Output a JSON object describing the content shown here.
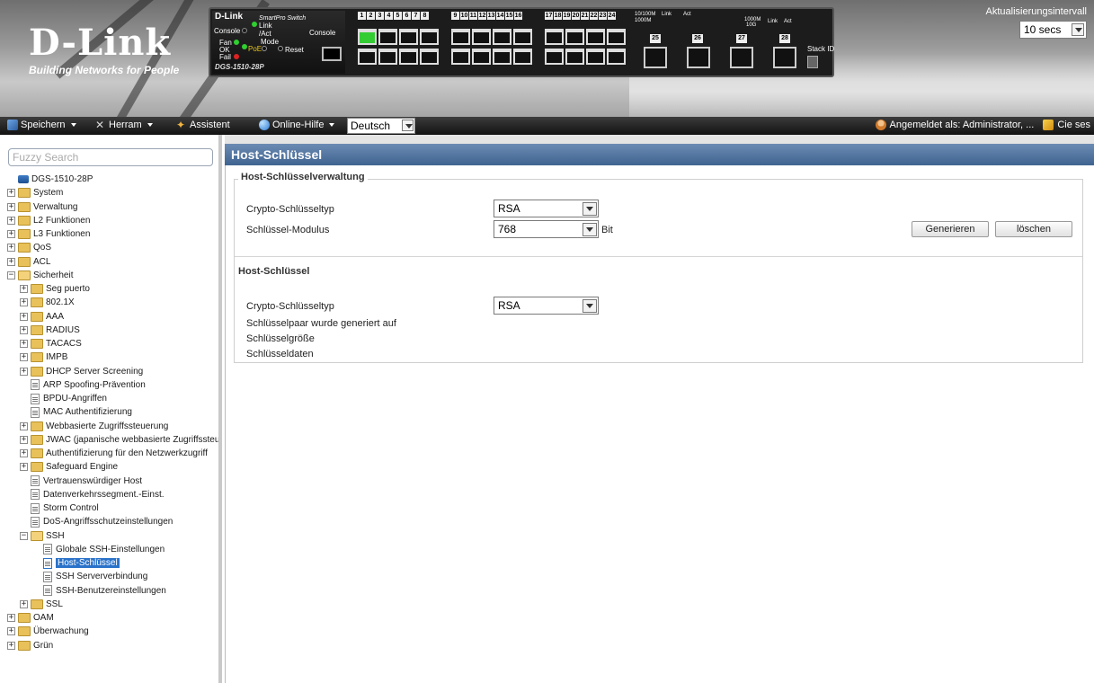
{
  "header": {
    "brand": "D-Link",
    "tagline": "Building Networks for People",
    "panel": {
      "brand": "D-Link",
      "series": "SmartPro Switch",
      "model": "DGS-1510-28P",
      "labels": {
        "console": "Console",
        "link_act": "Link /Act",
        "fan": "Fan",
        "ok": "OK",
        "fail": "Fail",
        "mode": "Mode",
        "poe": "PoE",
        "reset": "Reset",
        "console_port": "Console",
        "stack_id": "Stack ID",
        "speed_1": "10/100M",
        "speed_2": "1000M",
        "speed_3": "1000M",
        "speed_4": "10G",
        "link": "Link",
        "act": "Act"
      },
      "port_numbers_1": [
        "1",
        "2",
        "3",
        "4",
        "5",
        "6",
        "7",
        "8"
      ],
      "port_numbers_2": [
        "9",
        "10",
        "11",
        "12",
        "13",
        "14",
        "15",
        "16"
      ],
      "port_numbers_3": [
        "17",
        "18",
        "19",
        "20",
        "21",
        "22",
        "23",
        "24"
      ],
      "sfp_numbers": [
        "25",
        "26",
        "27",
        "28"
      ]
    },
    "refresh": {
      "label": "Aktualisierungsintervall",
      "value": "10 secs"
    }
  },
  "toolbar": {
    "save": "Speichern",
    "tools": "Herram",
    "wizard": "Assistent",
    "help": "Online-Hilfe",
    "language": "Deutsch",
    "user": "Angemeldet als: Administrator, ...",
    "logout": "Cie ses"
  },
  "sidebar": {
    "search_placeholder": "Fuzzy Search",
    "tree": [
      {
        "label": "DGS-1510-28P"
      },
      {
        "label": "System"
      },
      {
        "label": "Verwaltung"
      },
      {
        "label": "L2 Funktionen"
      },
      {
        "label": "L3 Funktionen"
      },
      {
        "label": "QoS"
      },
      {
        "label": "ACL"
      },
      {
        "label": "Sicherheit"
      },
      {
        "label": "Seg puerto"
      },
      {
        "label": "802.1X"
      },
      {
        "label": "AAA"
      },
      {
        "label": "RADIUS"
      },
      {
        "label": "TACACS"
      },
      {
        "label": "IMPB"
      },
      {
        "label": "DHCP Server Screening"
      },
      {
        "label": "ARP Spoofing-Prävention"
      },
      {
        "label": "BPDU-Angriffen"
      },
      {
        "label": "MAC Authentifizierung"
      },
      {
        "label": "Webbasierte Zugriffssteuerung"
      },
      {
        "label": "JWAC (japanische webbasierte Zugriffssteue"
      },
      {
        "label": "Authentifizierung für den Netzwerkzugriff"
      },
      {
        "label": "Safeguard Engine"
      },
      {
        "label": "Vertrauenswürdiger Host"
      },
      {
        "label": "Datenverkehrssegment.-Einst."
      },
      {
        "label": "Storm Control"
      },
      {
        "label": "DoS-Angriffsschutzeinstellungen"
      },
      {
        "label": "SSH"
      },
      {
        "label": "Globale SSH-Einstellungen"
      },
      {
        "label": "Host-Schlüssel"
      },
      {
        "label": "SSH Serververbindung"
      },
      {
        "label": "SSH-Benutzereinstellungen"
      },
      {
        "label": "SSL"
      },
      {
        "label": "OAM"
      },
      {
        "label": "Überwachung"
      },
      {
        "label": "Grün"
      }
    ]
  },
  "main": {
    "title": "Host-Schlüssel",
    "mgmt": {
      "legend": "Host-Schlüsselverwaltung",
      "crypto_label": "Crypto-Schlüsseltyp",
      "crypto_value": "RSA",
      "modulus_label": "Schlüssel-Modulus",
      "modulus_value": "768",
      "modulus_unit": "Bit",
      "generate_button": "Generieren",
      "delete_button": "löschen"
    },
    "info": {
      "heading": "Host-Schlüssel",
      "crypto_label": "Crypto-Schlüsseltyp",
      "crypto_value": "RSA",
      "generated_label": "Schlüsselpaar wurde generiert auf",
      "size_label": "Schlüsselgröße",
      "data_label": "Schlüsseldaten"
    }
  }
}
